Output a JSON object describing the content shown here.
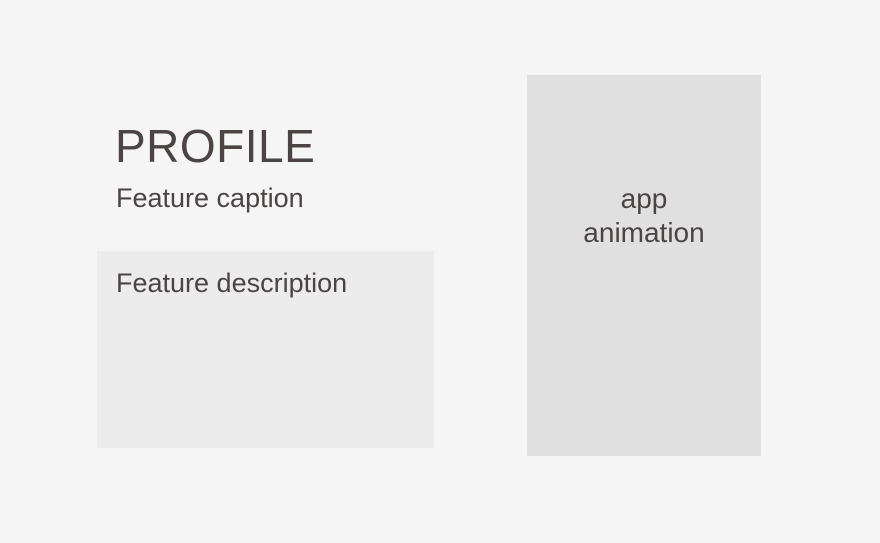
{
  "feature": {
    "title": "PROFILE",
    "caption": "Feature caption",
    "description": "Feature description"
  },
  "app_animation": {
    "line1": "app",
    "line2": "animation"
  },
  "colors": {
    "page_background": "#f5f5f5",
    "description_background": "#ececec",
    "animation_background": "#e0e0e0",
    "text": "#4a4444"
  }
}
